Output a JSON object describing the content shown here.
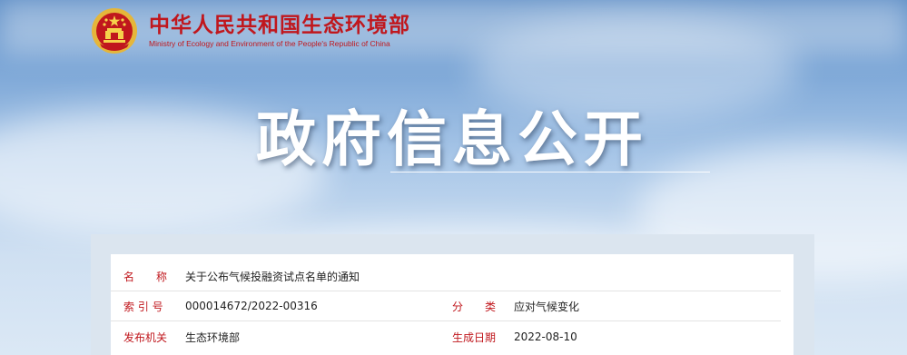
{
  "header": {
    "title": "中华人民共和国生态环境部",
    "subtitle": "Ministry of Ecology and Environment of the People's Republic of China"
  },
  "banner": {
    "title": "政府信息公开"
  },
  "info": {
    "name_label": "名　　称",
    "name_value": "关于公布气候投融资试点名单的通知",
    "index_label": "索 引 号",
    "index_value": "000014672/2022-00316",
    "category_label": "分　　类",
    "category_value": "应对气候变化",
    "issuer_label": "发布机关",
    "issuer_value": "生态环境部",
    "date_label": "生成日期",
    "date_value": "2022-08-10"
  },
  "colors": {
    "brand_red": "#c0171d",
    "emblem_gold": "#e5b63a"
  },
  "icons": {
    "emblem": "national-emblem-icon"
  }
}
